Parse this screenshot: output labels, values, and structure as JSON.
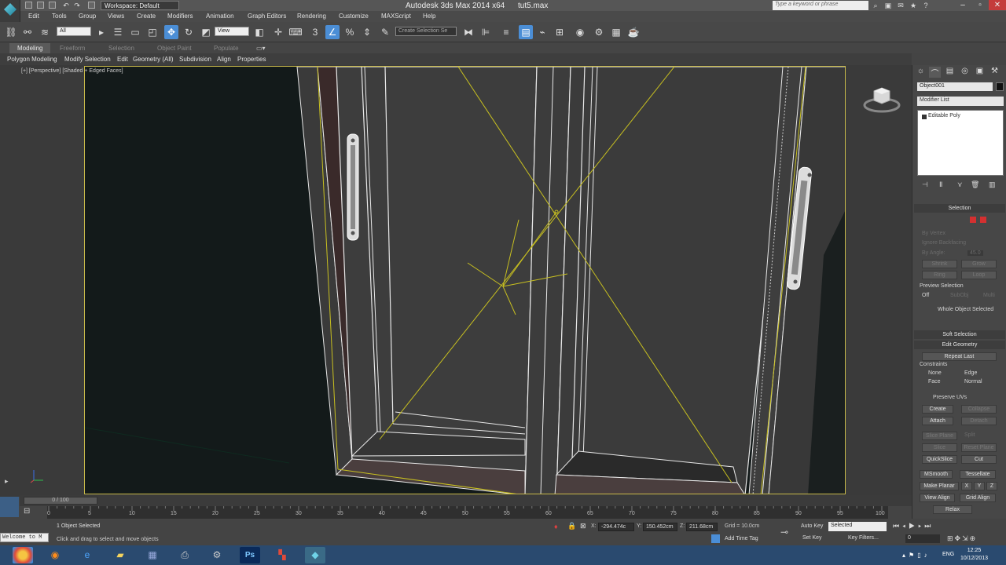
{
  "titlebar": {
    "workspace": "Workspace: Default",
    "app_title": "Autodesk 3ds Max  2014 x64",
    "file_title": "tut5.max",
    "search_placeholder": "Type a keyword or phrase"
  },
  "menu": [
    "Edit",
    "Tools",
    "Group",
    "Views",
    "Create",
    "Modifiers",
    "Animation",
    "Graph Editors",
    "Rendering",
    "Customize",
    "MAXScript",
    "Help"
  ],
  "toolbar": {
    "filter": "All",
    "ref_coord": "View",
    "named_selection": "Create Selection Se"
  },
  "ribbon": {
    "tabs": [
      "Modeling",
      "Freeform",
      "Selection",
      "Object Paint",
      "Populate"
    ],
    "active_tab": "Modeling",
    "subtabs": [
      "Polygon Modeling",
      "Modify Selection",
      "Edit",
      "Geometry (All)",
      "Subdivision",
      "Align",
      "Properties"
    ]
  },
  "viewport": {
    "label": "[+] [Perspective] [Shaded + Edged Faces]",
    "colors": {
      "frame": "#c8b94a",
      "door": "#3c3c3c",
      "edges": "#e8e8e8",
      "selection": "#c8c020"
    }
  },
  "command_panel": {
    "object_name": "Object001",
    "modifier_list": "Modifier List",
    "stack_item": "Editable Poly",
    "selection": {
      "title": "Selection",
      "by_vertex": "By Vertex",
      "ignore_backfacing": "Ignore Backfacing",
      "by_angle": "By Angle:",
      "angle_value": "45.0",
      "shrink": "Shrink",
      "grow": "Grow",
      "ring": "Ring",
      "loop": "Loop",
      "preview_selection": "Preview Selection",
      "off": "Off",
      "subobj": "SubObj",
      "multi": "Multi",
      "status": "Whole Object Selected"
    },
    "soft_selection": "Soft Selection",
    "edit_geometry": {
      "title": "Edit Geometry",
      "repeat_last": "Repeat Last",
      "constraints": "Constraints",
      "none": "None",
      "edge": "Edge",
      "face": "Face",
      "normal": "Normal",
      "preserve_uvs": "Preserve UVs",
      "create": "Create",
      "collapse": "Collapse",
      "attach": "Attach",
      "detach": "Detach",
      "slice_plane": "Slice Plane",
      "split": "Split",
      "slice": "Slice",
      "reset_plane": "Reset Plane",
      "quickslice": "QuickSlice",
      "cut": "Cut",
      "msmooth": "MSmooth",
      "tessellate": "Tessellate",
      "make_planar": "Make Planar",
      "x": "X",
      "y": "Y",
      "z": "Z",
      "view_align": "View Align",
      "grid_align": "Grid Align",
      "relax": "Relax"
    }
  },
  "timeline": {
    "slider": "0 / 100",
    "ticks": [
      "0",
      "5",
      "10",
      "15",
      "20",
      "25",
      "30",
      "35",
      "40",
      "45",
      "50",
      "55",
      "60",
      "65",
      "70",
      "75",
      "80",
      "85",
      "90",
      "95",
      "100"
    ]
  },
  "status": {
    "welcome": "Welcome to M",
    "selected": "1 Object Selected",
    "prompt": "Click and drag to select and move objects",
    "x": "-294.474c",
    "y": "150.452cm",
    "z": "211.68cm",
    "grid": "Grid = 10.0cm",
    "auto_key": "Auto Key",
    "set_key": "Set Key",
    "selected_set": "Selected",
    "key_filters": "Key Filters...",
    "add_time_tag": "Add Time Tag",
    "frame": "0"
  },
  "taskbar": {
    "lang": "ENG",
    "time": "12:25",
    "date": "10/12/2013"
  }
}
